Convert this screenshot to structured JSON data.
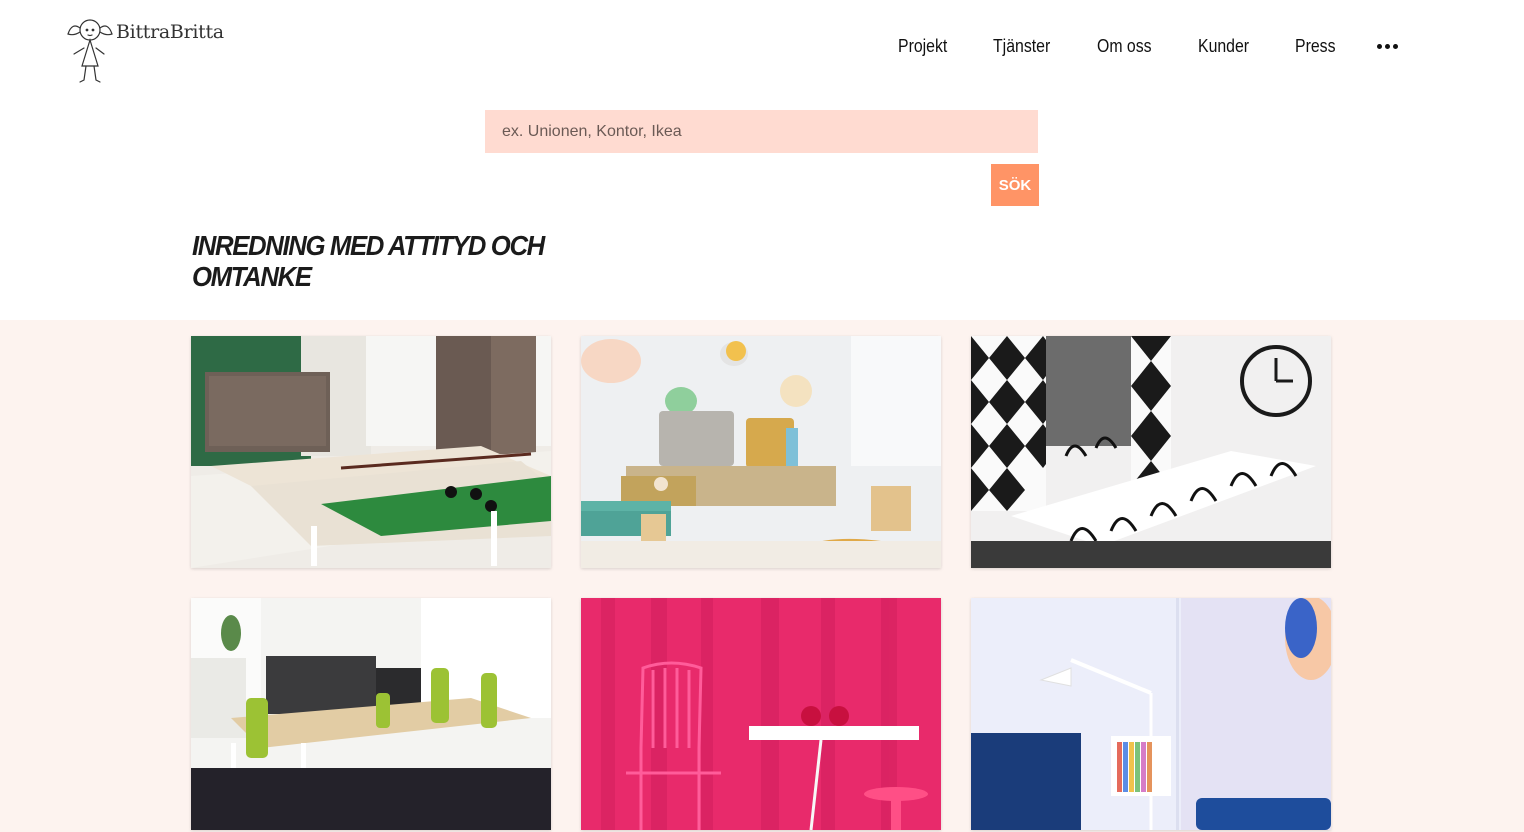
{
  "brand": {
    "name": "BittraBritta"
  },
  "nav": {
    "items": [
      {
        "label": "Projekt"
      },
      {
        "label": "Tjänster"
      },
      {
        "label": "Om oss"
      },
      {
        "label": "Kunder"
      },
      {
        "label": "Press"
      }
    ],
    "more_icon": "ellipsis-icon"
  },
  "search": {
    "placeholder": "ex. Unionen, Kontor, Ikea",
    "value": "",
    "button_label": "SÖK"
  },
  "tagline": "INREDNING MED ATTITYD OCH OMTANKE",
  "colors": {
    "search_bg": "#ffdbd1",
    "button_bg": "#ff9466",
    "section_bg": "#fdf3ef"
  },
  "project_tiles": [
    {
      "image": "office-pool-table-photo"
    },
    {
      "image": "colorful-lounge-photo"
    },
    {
      "image": "black-white-conference-room-photo"
    },
    {
      "image": "green-chairs-workspace-photo"
    },
    {
      "image": "pink-curtain-chair-photo"
    },
    {
      "image": "blue-sofa-lamp-photo"
    }
  ]
}
